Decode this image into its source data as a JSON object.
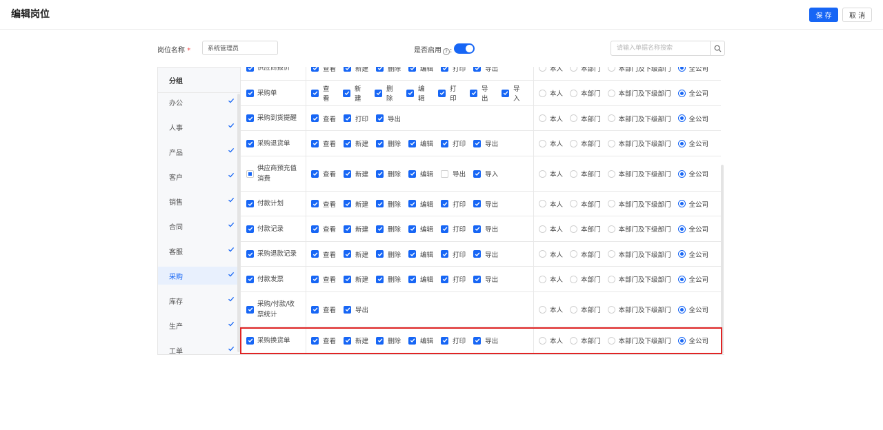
{
  "header": {
    "title": "编辑岗位",
    "save_label": "保 存",
    "cancel_label": "取 消"
  },
  "form": {
    "name_label": "岗位名称",
    "required_mark": "*",
    "name_value": "系统管理员",
    "enabled_label": "是否启用",
    "enabled": true,
    "search_placeholder": "请输入单据名称搜索"
  },
  "groups": {
    "header": "分组",
    "items": [
      {
        "label": "办公",
        "checked": true,
        "active": false
      },
      {
        "label": "人事",
        "checked": true,
        "active": false
      },
      {
        "label": "产品",
        "checked": true,
        "active": false
      },
      {
        "label": "客户",
        "checked": true,
        "active": false
      },
      {
        "label": "销售",
        "checked": true,
        "active": false
      },
      {
        "label": "合同",
        "checked": true,
        "active": false
      },
      {
        "label": "客服",
        "checked": true,
        "active": false
      },
      {
        "label": "采购",
        "checked": true,
        "active": true
      },
      {
        "label": "库存",
        "checked": true,
        "active": false
      },
      {
        "label": "生产",
        "checked": true,
        "active": false
      },
      {
        "label": "工单",
        "checked": true,
        "active": false
      }
    ]
  },
  "scope_options": [
    "本人",
    "本部门",
    "本部门及下级部门",
    "全公司"
  ],
  "rows": [
    {
      "name": "供应商报价",
      "state": "checked",
      "perms": [
        {
          "label": "查看",
          "on": true
        },
        {
          "label": "新建",
          "on": true
        },
        {
          "label": "删除",
          "on": true
        },
        {
          "label": "编辑",
          "on": true
        },
        {
          "label": "打印",
          "on": true
        },
        {
          "label": "导出",
          "on": true
        }
      ],
      "scope": 3
    },
    {
      "name": "采购单",
      "state": "checked",
      "perms": [
        {
          "label": "查看",
          "on": true
        },
        {
          "label": "新建",
          "on": true
        },
        {
          "label": "删除",
          "on": true
        },
        {
          "label": "编辑",
          "on": true
        },
        {
          "label": "打印",
          "on": true
        },
        {
          "label": "导出",
          "on": true
        },
        {
          "label": "导入",
          "on": true
        }
      ],
      "scope": 3
    },
    {
      "name": "采购到货提醒",
      "state": "checked",
      "perms": [
        {
          "label": "查看",
          "on": true
        },
        {
          "label": "打印",
          "on": true
        },
        {
          "label": "导出",
          "on": true
        }
      ],
      "scope": 3
    },
    {
      "name": "采购退货单",
      "state": "checked",
      "perms": [
        {
          "label": "查看",
          "on": true
        },
        {
          "label": "新建",
          "on": true
        },
        {
          "label": "删除",
          "on": true
        },
        {
          "label": "编辑",
          "on": true
        },
        {
          "label": "打印",
          "on": true
        },
        {
          "label": "导出",
          "on": true
        }
      ],
      "scope": 3
    },
    {
      "name": "供应商预充值消费",
      "state": "partial",
      "perms": [
        {
          "label": "查看",
          "on": true
        },
        {
          "label": "新建",
          "on": true
        },
        {
          "label": "删除",
          "on": true
        },
        {
          "label": "编辑",
          "on": true
        },
        {
          "label": "导出",
          "on": false
        },
        {
          "label": "导入",
          "on": true
        }
      ],
      "scope": 3
    },
    {
      "name": "付款计划",
      "state": "checked",
      "perms": [
        {
          "label": "查看",
          "on": true
        },
        {
          "label": "新建",
          "on": true
        },
        {
          "label": "删除",
          "on": true
        },
        {
          "label": "编辑",
          "on": true
        },
        {
          "label": "打印",
          "on": true
        },
        {
          "label": "导出",
          "on": true
        }
      ],
      "scope": 3
    },
    {
      "name": "付款记录",
      "state": "checked",
      "perms": [
        {
          "label": "查看",
          "on": true
        },
        {
          "label": "新建",
          "on": true
        },
        {
          "label": "删除",
          "on": true
        },
        {
          "label": "编辑",
          "on": true
        },
        {
          "label": "打印",
          "on": true
        },
        {
          "label": "导出",
          "on": true
        }
      ],
      "scope": 3
    },
    {
      "name": "采购退款记录",
      "state": "checked",
      "perms": [
        {
          "label": "查看",
          "on": true
        },
        {
          "label": "新建",
          "on": true
        },
        {
          "label": "删除",
          "on": true
        },
        {
          "label": "编辑",
          "on": true
        },
        {
          "label": "打印",
          "on": true
        },
        {
          "label": "导出",
          "on": true
        }
      ],
      "scope": 3
    },
    {
      "name": "付款发票",
      "state": "checked",
      "perms": [
        {
          "label": "查看",
          "on": true
        },
        {
          "label": "新建",
          "on": true
        },
        {
          "label": "删除",
          "on": true
        },
        {
          "label": "编辑",
          "on": true
        },
        {
          "label": "打印",
          "on": true
        },
        {
          "label": "导出",
          "on": true
        }
      ],
      "scope": 3
    },
    {
      "name": "采购/付款/收票统计",
      "state": "checked",
      "perms": [
        {
          "label": "查看",
          "on": true
        },
        {
          "label": "导出",
          "on": true
        }
      ],
      "scope": 3
    },
    {
      "name": "采购换货单",
      "state": "checked",
      "perms": [
        {
          "label": "查看",
          "on": true
        },
        {
          "label": "新建",
          "on": true
        },
        {
          "label": "删除",
          "on": true
        },
        {
          "label": "编辑",
          "on": true
        },
        {
          "label": "打印",
          "on": true
        },
        {
          "label": "导出",
          "on": true
        }
      ],
      "scope": 3
    }
  ],
  "colors": {
    "accent": "#1766f5",
    "highlight": "#e02424"
  }
}
